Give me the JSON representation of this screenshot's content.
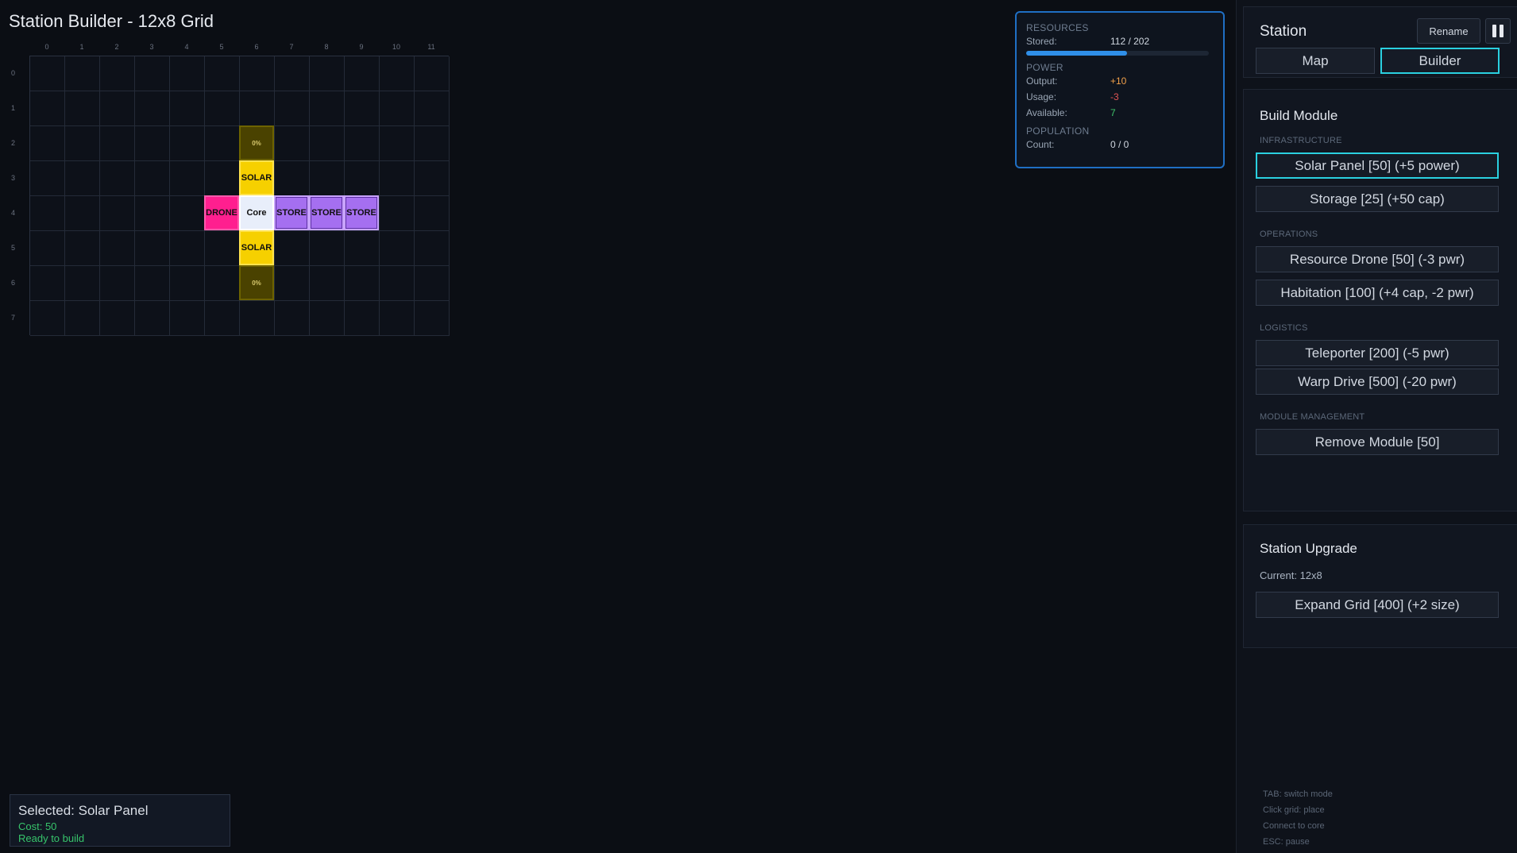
{
  "title": "Station Builder - 12x8 Grid",
  "grid": {
    "cols": 12,
    "rows": 8,
    "col_labels": [
      "0",
      "1",
      "2",
      "3",
      "4",
      "5",
      "6",
      "7",
      "8",
      "9",
      "10",
      "11"
    ],
    "row_labels": [
      "0",
      "1",
      "2",
      "3",
      "4",
      "5",
      "6",
      "7"
    ]
  },
  "modules": [
    {
      "type": "solar-ghost",
      "label": "0%",
      "col": 6,
      "row": 2
    },
    {
      "type": "solar",
      "label": "SOLAR",
      "col": 6,
      "row": 3
    },
    {
      "type": "drone",
      "label": "DRONE",
      "col": 5,
      "row": 4
    },
    {
      "type": "core",
      "label": "Core",
      "col": 6,
      "row": 4
    },
    {
      "type": "store",
      "label": "STORE",
      "col": 7,
      "row": 4
    },
    {
      "type": "store",
      "label": "STORE",
      "col": 8,
      "row": 4
    },
    {
      "type": "store",
      "label": "STORE",
      "col": 9,
      "row": 4
    },
    {
      "type": "solar",
      "label": "SOLAR",
      "col": 6,
      "row": 5
    },
    {
      "type": "solar-ghost",
      "label": "0%",
      "col": 6,
      "row": 6
    }
  ],
  "resources": {
    "section": "RESOURCES",
    "stored_label": "Stored:",
    "stored_value": "112 / 202",
    "stored_fraction": 0.554,
    "power_section": "POWER",
    "output_label": "Output:",
    "output_value": "+10",
    "usage_label": "Usage:",
    "usage_value": "-3",
    "available_label": "Available:",
    "available_value": "7",
    "population_section": "POPULATION",
    "count_label": "Count:",
    "count_value": "0 / 0"
  },
  "station": {
    "title": "Station",
    "rename_label": "Rename",
    "pause_icon": "pause-icon",
    "tab_map": "Map",
    "tab_builder": "Builder"
  },
  "build": {
    "title": "Build Module",
    "infrastructure_label": "INFRASTRUCTURE",
    "solar_panel": "Solar Panel [50] (+5 power)",
    "storage": "Storage [25] (+50 cap)",
    "operations_label": "OPERATIONS",
    "resource_drone": "Resource Drone [50] (-3 pwr)",
    "habitation": "Habitation [100] (+4 cap, -2 pwr)",
    "logistics_label": "LOGISTICS",
    "teleporter": "Teleporter [200] (-5 pwr)",
    "warp_drive": "Warp Drive [500] (-20 pwr)",
    "management_label": "MODULE MANAGEMENT",
    "remove_module": "Remove Module [50]"
  },
  "upgrade": {
    "title": "Station Upgrade",
    "current": "Current: 12x8",
    "expand": "Expand Grid [400] (+2 size)"
  },
  "hints": [
    "TAB: switch mode",
    "Click grid: place",
    "Connect to core",
    "ESC: pause"
  ],
  "selected": {
    "title": "Selected: Solar Panel",
    "cost": "Cost: 50",
    "status": "Ready to build"
  }
}
